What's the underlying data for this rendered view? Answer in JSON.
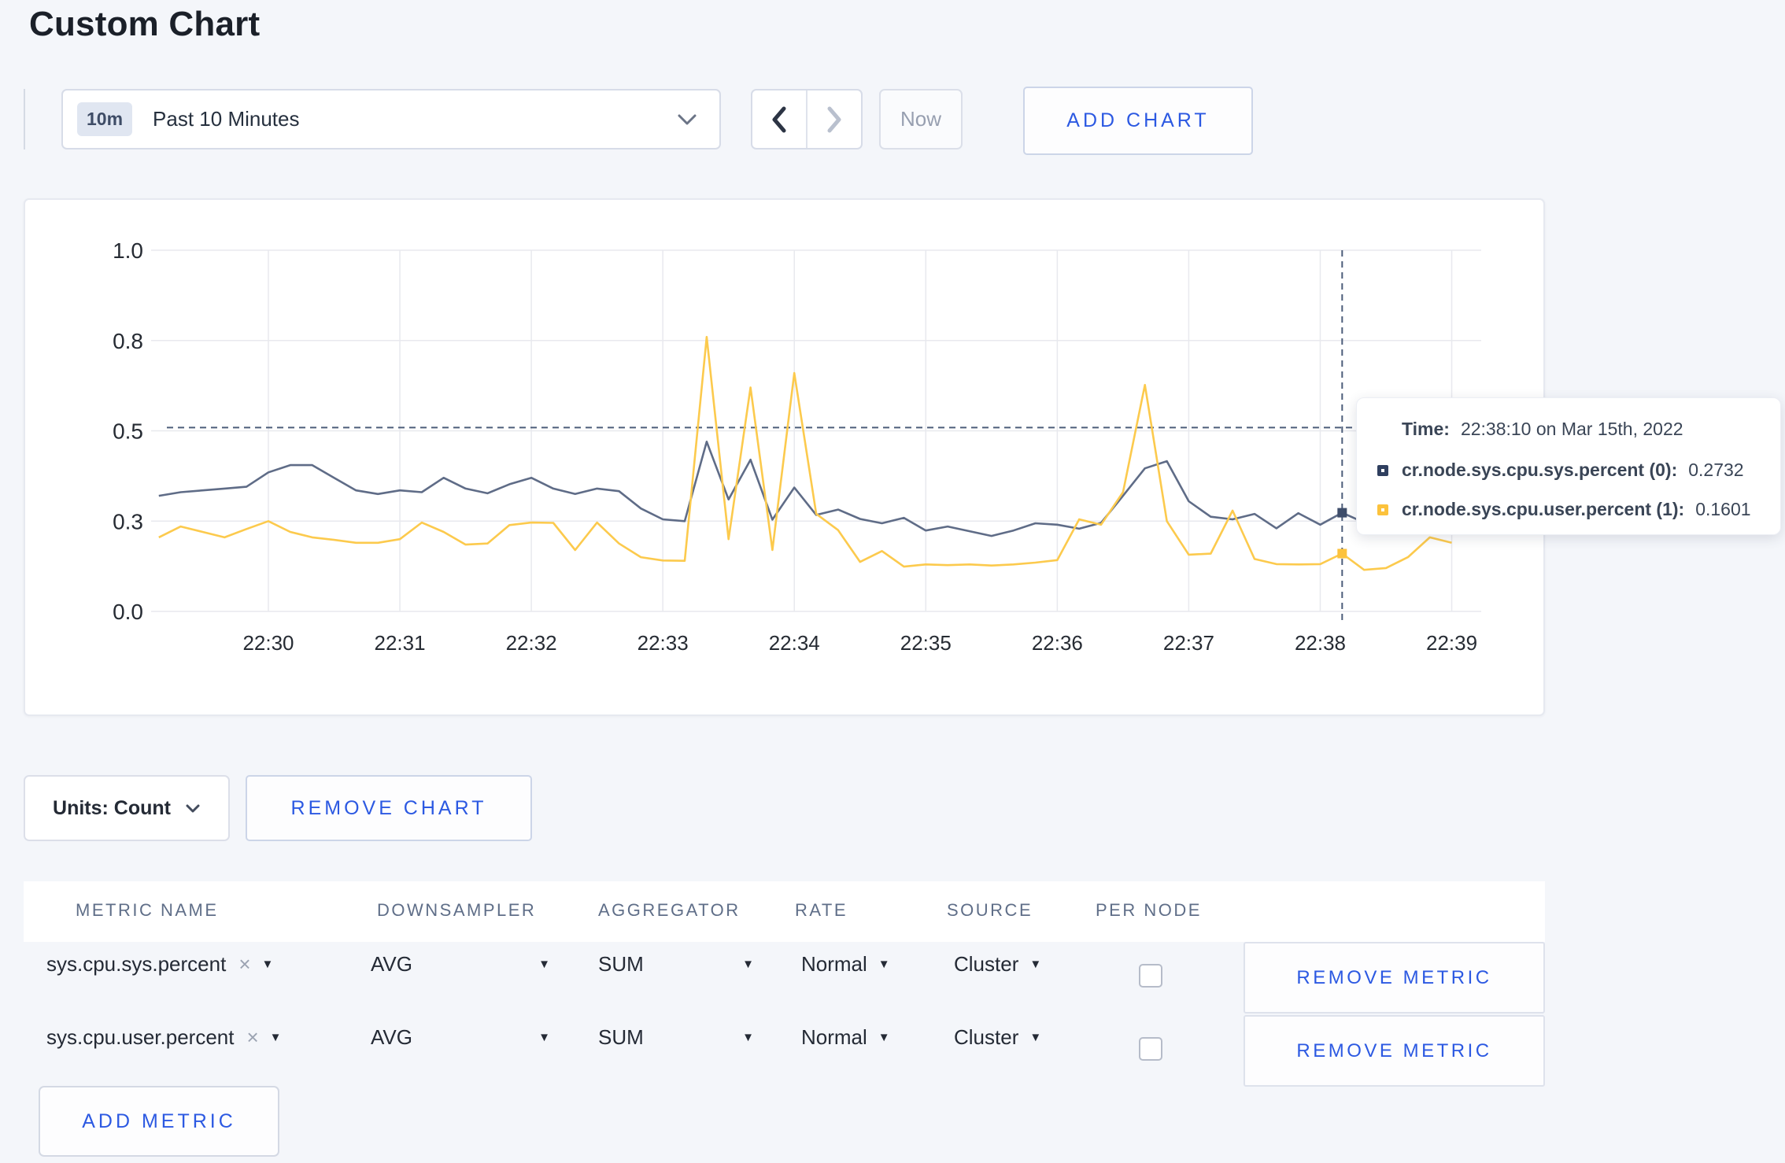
{
  "header": {
    "title": "Custom Chart"
  },
  "toolbar": {
    "time_window_badge": "10m",
    "time_window_label": "Past 10 Minutes",
    "now_label": "Now",
    "add_chart_label": "ADD CHART"
  },
  "icons": {
    "caret_down": "▼",
    "close": "×"
  },
  "chart_data": {
    "type": "line",
    "title": "",
    "xlabel": "",
    "ylabel": "",
    "grid": true,
    "ylim": [
      0,
      1
    ],
    "x_ticks": [
      "22:30",
      "22:31",
      "22:32",
      "22:33",
      "22:34",
      "22:35",
      "22:36",
      "22:37",
      "22:38",
      "22:39"
    ],
    "y_ticks": [
      {
        "v": 0.0,
        "label": "0.0"
      },
      {
        "v": 0.25,
        "label": "0.3"
      },
      {
        "v": 0.5,
        "label": "0.5"
      },
      {
        "v": 0.75,
        "label": "0.8"
      },
      {
        "v": 1.0,
        "label": "1.0"
      }
    ],
    "x_start_time": "22:29:10",
    "x_offset_seconds_from_first_tick": -50,
    "step_seconds": 10,
    "series": [
      {
        "name": "cr.node.sys.cpu.sys.percent (0)",
        "color": "#5f6c87",
        "values": [
          0.32,
          0.33,
          0.335,
          0.34,
          0.345,
          0.385,
          0.405,
          0.405,
          0.37,
          0.335,
          0.325,
          0.335,
          0.33,
          0.37,
          0.34,
          0.327,
          0.352,
          0.37,
          0.34,
          0.325,
          0.34,
          0.333,
          0.285,
          0.255,
          0.25,
          0.47,
          0.31,
          0.42,
          0.254,
          0.343,
          0.267,
          0.282,
          0.256,
          0.244,
          0.259,
          0.224,
          0.235,
          0.222,
          0.209,
          0.224,
          0.244,
          0.24,
          0.229,
          0.245,
          0.32,
          0.396,
          0.416,
          0.305,
          0.262,
          0.255,
          0.27,
          0.23,
          0.272,
          0.24,
          0.2732,
          0.246,
          0.26,
          0.29,
          0.27,
          0.28
        ]
      },
      {
        "name": "cr.node.sys.cpu.user.percent (1)",
        "color": "#fcca4d",
        "values": [
          0.205,
          0.235,
          0.22,
          0.205,
          0.228,
          0.25,
          0.22,
          0.205,
          0.198,
          0.19,
          0.19,
          0.2,
          0.246,
          0.22,
          0.185,
          0.188,
          0.239,
          0.246,
          0.245,
          0.17,
          0.246,
          0.188,
          0.15,
          0.141,
          0.14,
          0.76,
          0.2,
          0.62,
          0.17,
          0.66,
          0.27,
          0.225,
          0.137,
          0.167,
          0.124,
          0.13,
          0.128,
          0.13,
          0.127,
          0.13,
          0.135,
          0.142,
          0.255,
          0.24,
          0.33,
          0.627,
          0.25,
          0.157,
          0.16,
          0.279,
          0.145,
          0.131,
          0.13,
          0.131,
          0.1601,
          0.115,
          0.12,
          0.15,
          0.205,
          0.19
        ]
      }
    ],
    "crosshair": {
      "index": 54,
      "time": "22:38:10",
      "y_guide_value": 0.509,
      "marker_colors": [
        "#3f4e6b",
        "#fcc23c"
      ]
    },
    "legend_position": "tooltip"
  },
  "tooltip": {
    "time_label": "Time:",
    "time_value": "22:38:10 on Mar 15th, 2022",
    "entries": [
      {
        "name": "cr.node.sys.cpu.sys.percent (0):",
        "value": "0.2732"
      },
      {
        "name": "cr.node.sys.cpu.user.percent (1):",
        "value": "0.1601"
      }
    ]
  },
  "chart_footer": {
    "units_label": "Units: Count",
    "remove_chart_label": "REMOVE CHART"
  },
  "metrics_table": {
    "headers": [
      "METRIC NAME",
      "DOWNSAMPLER",
      "AGGREGATOR",
      "RATE",
      "SOURCE",
      "PER NODE"
    ],
    "rows": [
      {
        "metric": "sys.cpu.sys.percent",
        "downsampler": "AVG",
        "aggregator": "SUM",
        "rate": "Normal",
        "source": "Cluster",
        "per_node_checked": false,
        "remove_label": "REMOVE METRIC"
      },
      {
        "metric": "sys.cpu.user.percent",
        "downsampler": "AVG",
        "aggregator": "SUM",
        "rate": "Normal",
        "source": "Cluster",
        "per_node_checked": false,
        "remove_label": "REMOVE METRIC"
      }
    ],
    "add_metric_label": "ADD METRIC"
  }
}
